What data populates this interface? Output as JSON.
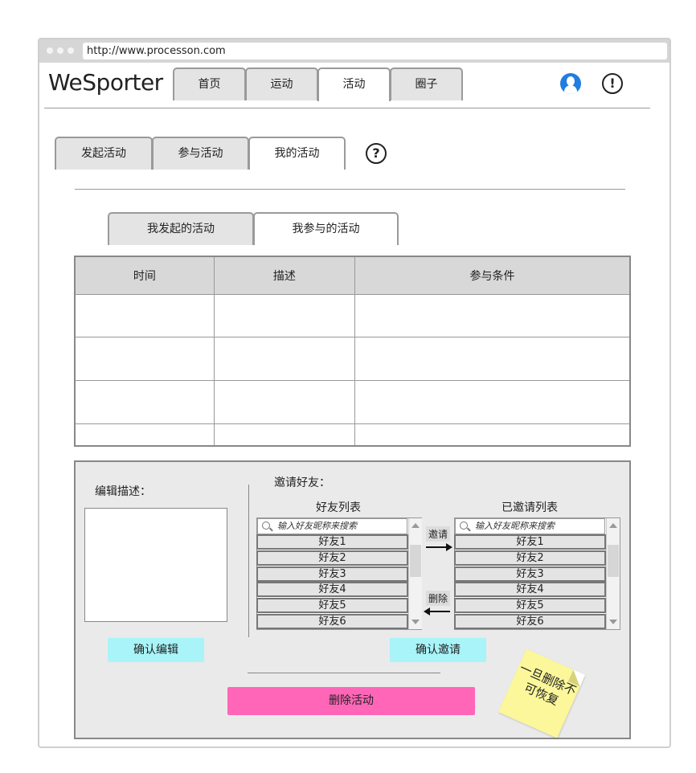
{
  "browser": {
    "url": "http://www.processon.com"
  },
  "app": {
    "logo": "WeSporter"
  },
  "nav": {
    "tabs": [
      {
        "label": "首页"
      },
      {
        "label": "运动"
      },
      {
        "label": "活动"
      },
      {
        "label": "圈子"
      }
    ],
    "active_tab": "活动",
    "icons": [
      "user-icon",
      "alert-icon"
    ],
    "alert_glyph": "!"
  },
  "subnav": {
    "tabs": [
      {
        "label": "发起活动"
      },
      {
        "label": "参与活动"
      },
      {
        "label": "我的活动"
      }
    ],
    "active_tab": "我的活动",
    "help_glyph": "?"
  },
  "my_activities": {
    "tabs": [
      {
        "label": "我发起的活动"
      },
      {
        "label": "我参与的活动"
      }
    ],
    "active_tab": "我参与的活动"
  },
  "table": {
    "columns": [
      "时间",
      "描述",
      "参与条件"
    ],
    "rows": [
      [
        "",
        "",
        ""
      ],
      [
        "",
        "",
        ""
      ],
      [
        "",
        "",
        ""
      ],
      [
        "",
        "",
        ""
      ]
    ]
  },
  "editor": {
    "edit_label": "编辑描述：",
    "textarea_value": "",
    "confirm_edit": "确认编辑",
    "invite_label": "邀请好友：",
    "friend_list_title": "好友列表",
    "invited_list_title": "已邀请列表",
    "search_placeholder": "输入好友昵称来搜索",
    "friends": [
      "好友1",
      "好友2",
      "好友3",
      "好友4",
      "好友5",
      "好友6"
    ],
    "invited": [
      "好友1",
      "好友2",
      "好友3",
      "好友4",
      "好友5",
      "好友6"
    ],
    "invite_action": "邀请",
    "remove_action": "删除",
    "confirm_invite": "确认邀请",
    "delete_activity": "删除活动",
    "sticky_note": "一旦删除不可恢复"
  },
  "colors": {
    "user_icon": "#1f7ee0",
    "confirm_button": "#a8f4f9",
    "delete_button": "#ff66b8",
    "sticky_note": "#fbf79a",
    "panel_bg": "#eaeaea"
  }
}
